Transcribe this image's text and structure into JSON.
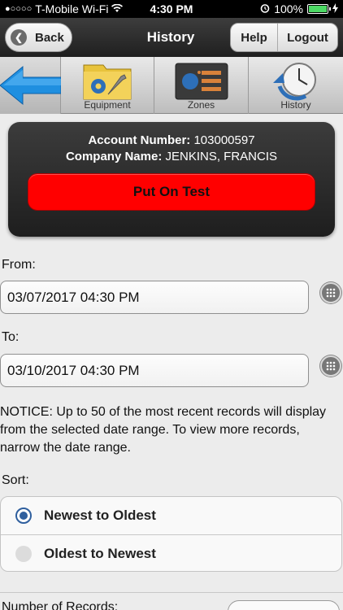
{
  "status_bar": {
    "carrier": "T-Mobile Wi-Fi",
    "time": "4:30 PM",
    "battery": "100%"
  },
  "nav": {
    "back_label": "Back",
    "title": "History",
    "help_label": "Help",
    "logout_label": "Logout"
  },
  "tabs": [
    {
      "label": ""
    },
    {
      "label": "Equipment"
    },
    {
      "label": "Zones"
    },
    {
      "label": "History"
    }
  ],
  "account": {
    "number_label": "Account Number:",
    "number": "103000597",
    "company_label": "Company Name:",
    "company": "JENKINS, FRANCIS",
    "test_button": "Put On Test"
  },
  "form": {
    "from_label": "From:",
    "from_value": "03/07/2017 04:30 PM",
    "to_label": "To:",
    "to_value": "03/10/2017 04:30 PM",
    "notice": "NOTICE: Up to 50 of the most recent records will display from the selected date range. To view more records, narrow the date range.",
    "sort_label": "Sort:",
    "sort_options": [
      {
        "label": "Newest to Oldest",
        "selected": true
      },
      {
        "label": "Oldest to Newest",
        "selected": false
      }
    ],
    "records_label": "Number of Records:"
  },
  "colors": {
    "accent_red": "#ff0000",
    "radio_blue": "#2f5f9e"
  }
}
